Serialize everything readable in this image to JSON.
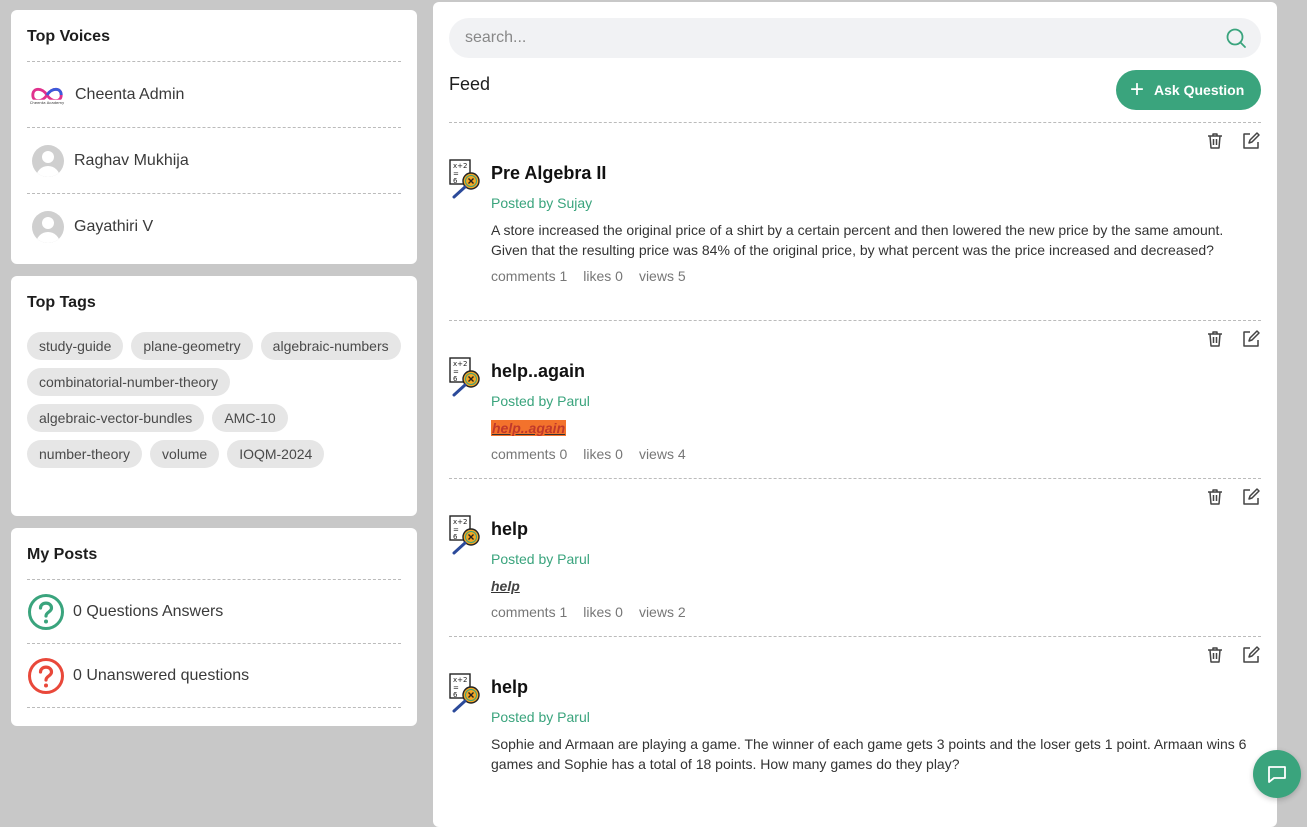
{
  "top_voices": {
    "title": "Top Voices",
    "users": [
      {
        "name": "Cheenta Admin",
        "avatar": "cheenta-logo-icon"
      },
      {
        "name": "Raghav Mukhija",
        "avatar": "default-user-icon"
      },
      {
        "name": "Gayathiri V",
        "avatar": "default-user-icon"
      }
    ]
  },
  "top_tags": {
    "title": "Top Tags",
    "tags": [
      "study-guide",
      "plane-geometry",
      "algebraic-numbers",
      "combinatorial-number-theory",
      "algebraic-vector-bundles",
      "AMC-10",
      "number-theory",
      "volume",
      "IOQM-2024"
    ]
  },
  "my_posts": {
    "title": "My Posts",
    "answered_label": "0 Questions Answers",
    "unanswered_label": "0 Unanswered questions"
  },
  "search": {
    "placeholder": "search..."
  },
  "feed": {
    "title": "Feed",
    "ask_label": "Ask Question",
    "posts": [
      {
        "title": "Pre Algebra II",
        "author": "Posted by Sujay",
        "text": "A store increased the original price of a shirt by a certain percent and then lowered the new price by the same amount. Given that the resulting price was 84% of the original price, by what percent was the price increased and decreased?",
        "comments": "comments 1",
        "likes": "likes 0",
        "views": "views 5"
      },
      {
        "title": "help..again",
        "author": "Posted by Parul",
        "text": "help..again",
        "comments": "comments 0",
        "likes": "likes 0",
        "views": "views 4"
      },
      {
        "title": "help",
        "author": "Posted by Parul",
        "text": "help",
        "comments": "comments 1",
        "likes": "likes 0",
        "views": "views 2"
      },
      {
        "title": "help",
        "author": "Posted by Parul",
        "text": "Sophie and Armaan are playing a game. The winner of each game gets 3 points and the loser gets 1 point. Armaan wins 6 games and Sophie has a total of 18 points. How many games do they play?"
      }
    ]
  },
  "colors": {
    "accent": "#3aa47d",
    "danger": "#e9483a",
    "highlight": "#f3722c"
  }
}
